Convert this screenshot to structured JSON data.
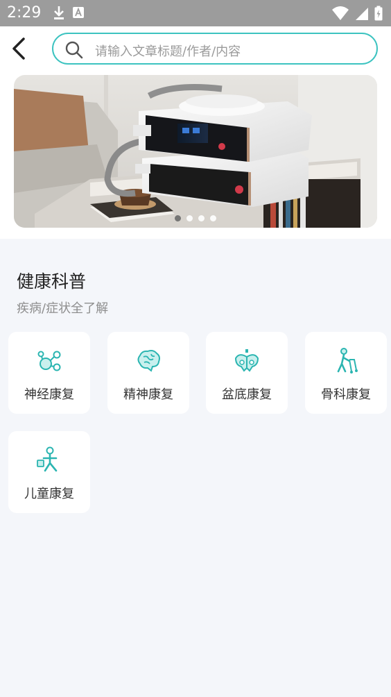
{
  "status_bar": {
    "time": "2:29"
  },
  "search": {
    "placeholder": "请输入文章标题/作者/内容"
  },
  "banner": {
    "dots_total": 4,
    "active_index": 0
  },
  "section": {
    "title": "健康科普",
    "subtitle": "疾病/症状全了解"
  },
  "categories": [
    {
      "label": "神经康复",
      "icon": "neuron-icon"
    },
    {
      "label": "精神康复",
      "icon": "brain-icon"
    },
    {
      "label": "盆底康复",
      "icon": "pelvis-icon"
    },
    {
      "label": "骨科康复",
      "icon": "walker-person-icon"
    },
    {
      "label": "儿童康复",
      "icon": "child-icon"
    }
  ],
  "colors": {
    "accent": "#3cc3c0",
    "background": "#f4f6fa"
  }
}
